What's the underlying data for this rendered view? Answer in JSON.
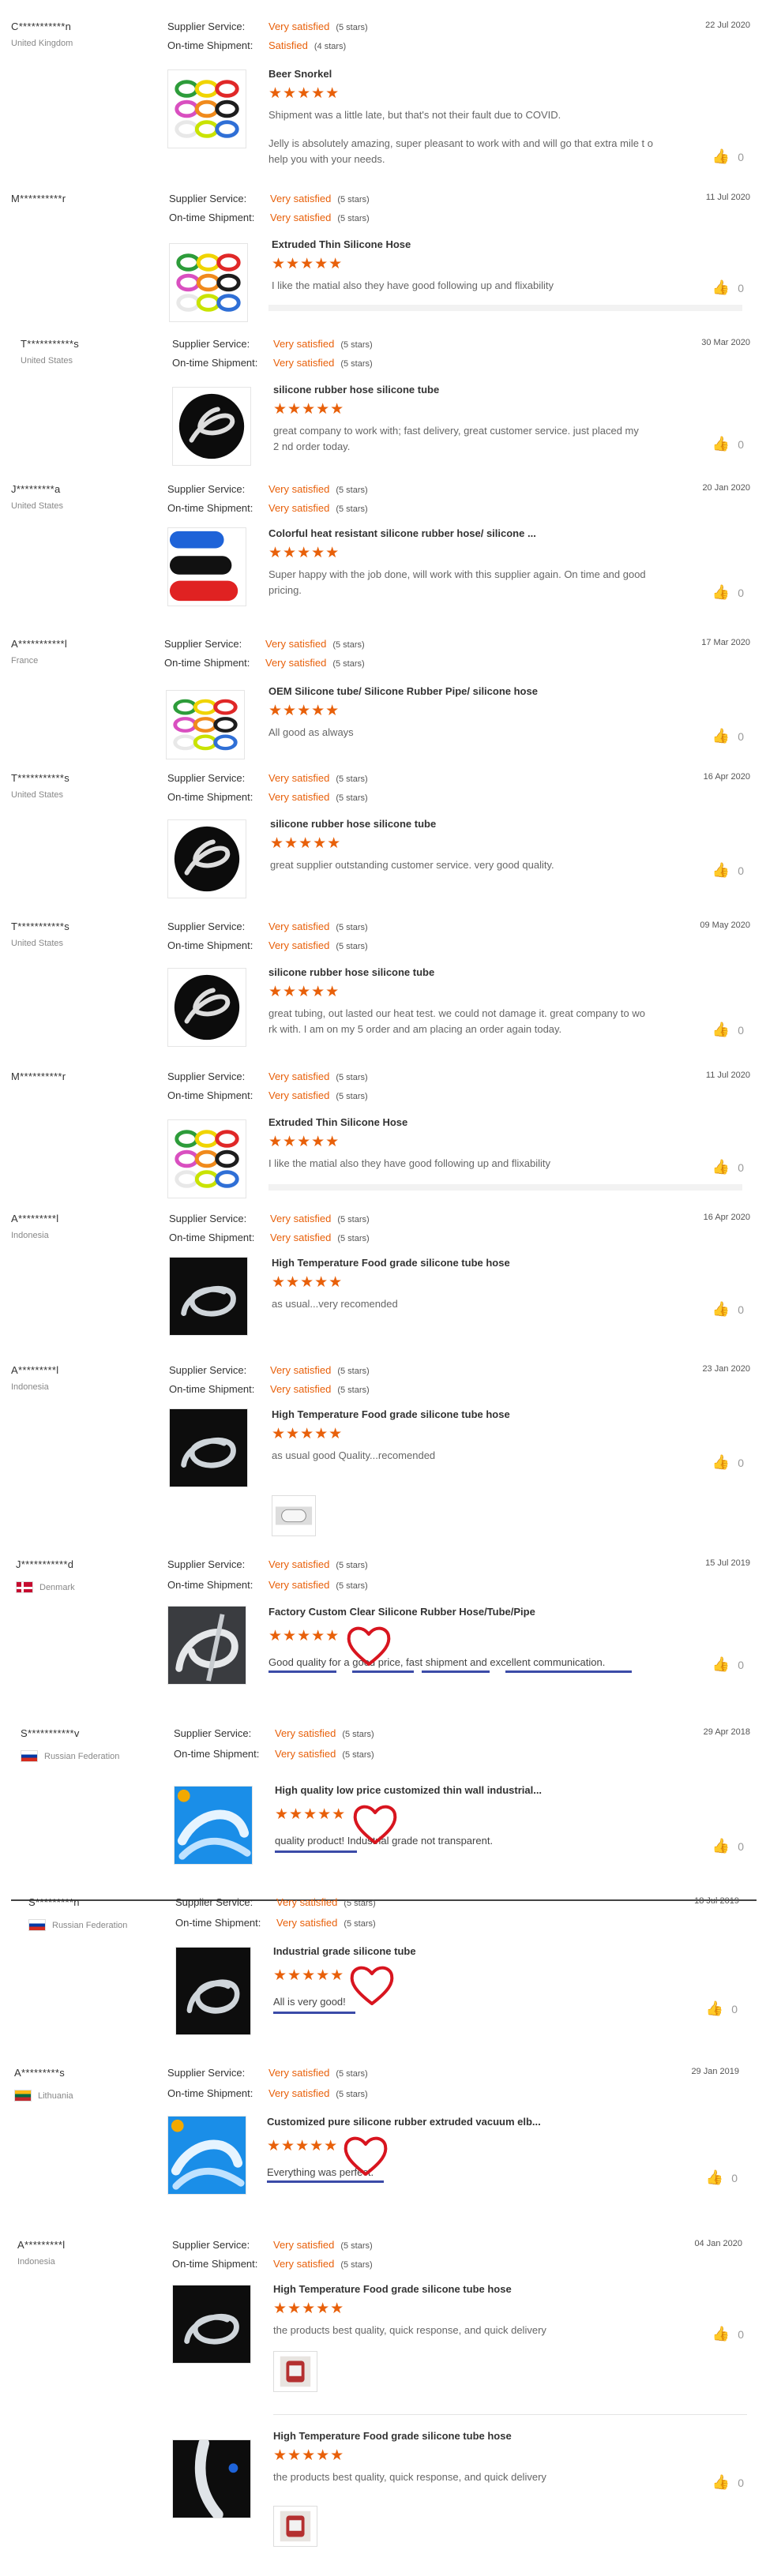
{
  "labels": {
    "supplier": "Supplier Service:",
    "shipment": "On-time Shipment:"
  },
  "colors": {
    "accent": "#e8600a",
    "underline": "#3b4ba8",
    "heart": "#d8151f"
  },
  "reviews": [
    {
      "name": "C***********n",
      "country": "United Kingdom",
      "supplier": "Very satisfied",
      "supplier_stars": "(5 stars)",
      "shipment": "Satisfied",
      "shipment_stars": "(4 stars)",
      "date": "22 Jul 2020",
      "product": "Beer Snorkel",
      "stars": "★★★★★",
      "comment": "Shipment was a little late, but that's not their fault due to COVID.",
      "comment2": "Jelly is absolutely amazing, super pleasant to work with and will go that extra mile t o help you with your needs.",
      "likes": "0",
      "thumb": "multi-color-hose-icon"
    },
    {
      "name": "M**********r",
      "supplier": "Very satisfied",
      "supplier_stars": "(5 stars)",
      "shipment": "Very satisfied",
      "shipment_stars": "(5 stars)",
      "date": "11 Jul 2020",
      "product": "Extruded Thin Silicone Hose",
      "stars": "★★★★★",
      "comment": "I like the  matial also    they have good following up and flixability",
      "likes": "0",
      "thumb": "multi-color-hose-icon"
    },
    {
      "name": "T***********s",
      "country": "United States",
      "supplier": "Very satisfied",
      "supplier_stars": "(5 stars)",
      "shipment": "Very satisfied",
      "shipment_stars": "(5 stars)",
      "date": "30 Mar 2020",
      "product": "silicone rubber hose silicone tube",
      "stars": "★★★★★",
      "comment": "great company to work with; fast delivery, great customer service. just placed my 2 nd order today.",
      "likes": "0",
      "thumb": "black-circle-tube-icon"
    },
    {
      "name": "J*********a",
      "country": "United States",
      "supplier": "Very satisfied",
      "supplier_stars": "(5 stars)",
      "shipment": "Very satisfied",
      "shipment_stars": "(5 stars)",
      "date": "20 Jan 2020",
      "product": "Colorful heat resistant silicone rubber hose/ silicone ...",
      "stars": "★★★★★",
      "comment": "Super happy with the job done, will work with this supplier again. On time and good pricing.",
      "likes": "0",
      "thumb": "color-tubes-icon"
    },
    {
      "name": "A***********l",
      "country": "France",
      "supplier": "Very satisfied",
      "supplier_stars": "(5 stars)",
      "shipment": "Very satisfied",
      "shipment_stars": "(5 stars)",
      "date": "17 Mar 2020",
      "product": "OEM Silicone tube/ Silicone Rubber Pipe/ silicone hose",
      "stars": "★★★★★",
      "comment": "All good as always",
      "likes": "0",
      "thumb": "multi-color-hose-icon"
    },
    {
      "name": "T***********s",
      "country": "United States",
      "supplier": "Very satisfied",
      "supplier_stars": "(5 stars)",
      "shipment": "Very satisfied",
      "shipment_stars": "(5 stars)",
      "date": "16 Apr 2020",
      "product": "silicone rubber hose silicone tube",
      "stars": "★★★★★",
      "comment": "great supplier outstanding customer service. very good quality.",
      "likes": "0",
      "thumb": "black-circle-tube-icon"
    },
    {
      "name": "T***********s",
      "country": "United States",
      "supplier": "Very satisfied",
      "supplier_stars": "(5 stars)",
      "shipment": "Very satisfied",
      "shipment_stars": "(5 stars)",
      "date": "09 May 2020",
      "product": "silicone rubber hose silicone tube",
      "stars": "★★★★★",
      "comment": "great tubing, out lasted our heat test. we could not damage it. great company to wo rk with. I am on my 5 order and am placing an order again today.",
      "likes": "0",
      "thumb": "black-circle-tube-icon"
    },
    {
      "name": "M**********r",
      "supplier": "Very satisfied",
      "supplier_stars": "(5 stars)",
      "shipment": "Very satisfied",
      "shipment_stars": "(5 stars)",
      "date": "11 Jul 2020",
      "product": "Extruded Thin Silicone Hose",
      "stars": "★★★★★",
      "comment": "I like the  matial also    they have good following up and flixability",
      "likes": "0",
      "thumb": "multi-color-hose-icon"
    },
    {
      "name": "A*********l",
      "country": "Indonesia",
      "supplier": "Very satisfied",
      "supplier_stars": "(5 stars)",
      "shipment": "Very satisfied",
      "shipment_stars": "(5 stars)",
      "date": "16 Apr 2020",
      "product": "High Temperature Food grade silicone tube hose",
      "stars": "★★★★★",
      "comment": "as usual...very recomended",
      "likes": "0",
      "thumb": "clear-tube-dark-icon"
    },
    {
      "name": "A*********l",
      "country": "Indonesia",
      "supplier": "Very satisfied",
      "supplier_stars": "(5 stars)",
      "shipment": "Very satisfied",
      "shipment_stars": "(5 stars)",
      "date": "23 Jan 2020",
      "product": "High Temperature Food grade silicone tube hose",
      "stars": "★★★★★",
      "comment": "as usual good Quality...recomended",
      "likes": "0",
      "thumb": "clear-tube-dark-icon"
    },
    {
      "name": "J***********d",
      "country": "Denmark",
      "supplier": "Very satisfied",
      "supplier_stars": "(5 stars)",
      "shipment": "Very satisfied",
      "shipment_stars": "(5 stars)",
      "date": "15 Jul 2019",
      "product": "Factory Custom Clear Silicone Rubber Hose/Tube/Pipe",
      "stars": "★★★★★",
      "comment": "Good quality for a good price, fast shipment and excellent communication.",
      "likes": "0",
      "thumb": "clear-tube-grey-icon"
    },
    {
      "name": "S***********v",
      "country": "Russian Federation",
      "supplier": "Very satisfied",
      "supplier_stars": "(5 stars)",
      "shipment": "Very satisfied",
      "shipment_stars": "(5 stars)",
      "date": "29 Apr 2018",
      "product": "High quality low price customized thin wall industrial...",
      "stars": "★★★★★",
      "comment": "quality product! Industrial grade not transparent.",
      "likes": "0",
      "thumb": "blue-tube-icon"
    },
    {
      "name": "S*********n",
      "country": "Russian Federation",
      "supplier": "Very satisfied",
      "supplier_stars": "(5 stars)",
      "shipment": "Very satisfied",
      "shipment_stars": "(5 stars)",
      "date": "18 Jul 2019",
      "product": "Industrial grade silicone tube",
      "stars": "★★★★★",
      "comment": "All is very good!",
      "likes": "0",
      "thumb": "clear-tube-dark-icon"
    },
    {
      "name": "A*********s",
      "country": "Lithuania",
      "supplier": "Very satisfied",
      "supplier_stars": "(5 stars)",
      "shipment": "Very satisfied",
      "shipment_stars": "(5 stars)",
      "date": "29 Jan 2019",
      "product": "Customized pure silicone rubber extruded vacuum elb...",
      "stars": "★★★★★",
      "comment": "Everything was perfect.",
      "likes": "0",
      "thumb": "blue-tube-icon"
    },
    {
      "name": "A*********l",
      "country": "Indonesia",
      "supplier": "Very satisfied",
      "supplier_stars": "(5 stars)",
      "shipment": "Very satisfied",
      "shipment_stars": "(5 stars)",
      "date": "04 Jan 2020",
      "product": "High Temperature Food grade silicone tube hose",
      "stars": "★★★★★",
      "comment": "the products best quality, quick response, and quick delivery",
      "likes": "0",
      "thumb": "clear-tube-dark-icon"
    }
  ],
  "extra": {
    "product": "High Temperature Food grade silicone tube hose",
    "stars": "★★★★★",
    "comment": "the products best quality, quick response, and quick delivery",
    "likes": "0",
    "thumb": "black-blue-tube-icon"
  }
}
